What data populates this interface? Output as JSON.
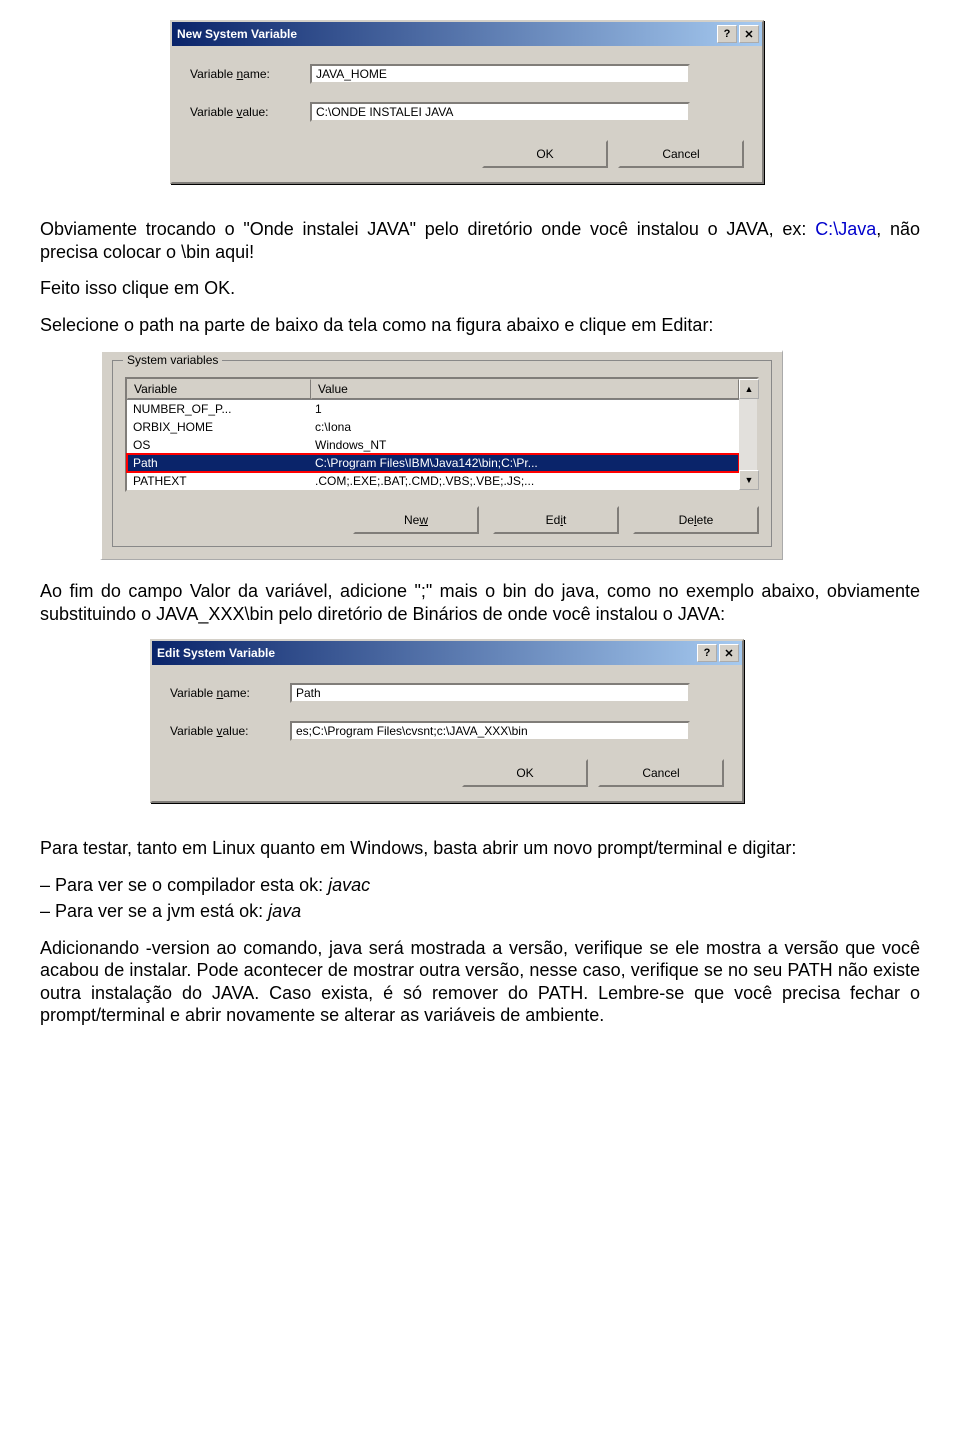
{
  "dialog1": {
    "title": "New System Variable",
    "name_label_pre": "Variable ",
    "name_label_u": "n",
    "name_label_post": "ame:",
    "name_value": "JAVA_HOME",
    "value_label_pre": "Variable ",
    "value_label_u": "v",
    "value_label_post": "alue:",
    "value_value": "C:\\ONDE INSTALEI JAVA",
    "ok": "OK",
    "cancel": "Cancel",
    "help_btn": "?",
    "close_btn": "✕"
  },
  "para1_a": "Obviamente trocando o \"Onde instalei JAVA\" pelo diretório onde você instalou o JAVA, ex: ",
  "para1_link": "C:\\Java",
  "para1_b": ", não precisa colocar o \\bin aqui!",
  "para2": "Feito isso clique em OK.",
  "para3": "Selecione o path na parte de baixo da tela como na figura abaixo e clique em Editar:",
  "sysvar": {
    "legend": "System variables",
    "col_variable": "Variable",
    "col_value": "Value",
    "rows": [
      {
        "name": "NUMBER_OF_P...",
        "value": "1"
      },
      {
        "name": "ORBIX_HOME",
        "value": "c:\\Iona"
      },
      {
        "name": "OS",
        "value": "Windows_NT"
      },
      {
        "name": "Path",
        "value": "C:\\Program Files\\IBM\\Java142\\bin;C:\\Pr..."
      },
      {
        "name": "PATHEXT",
        "value": ".COM;.EXE;.BAT;.CMD;.VBS;.VBE;.JS;..."
      }
    ],
    "btn_new_u": "w",
    "btn_new_pre": "Ne",
    "btn_edit_u": "i",
    "btn_edit_pre": "Ed",
    "btn_edit_post": "t",
    "btn_delete_u": "l",
    "btn_delete_pre": "De",
    "btn_delete_post": "ete",
    "scroll_up": "▲",
    "scroll_down": "▼"
  },
  "para4": "Ao fim do campo Valor da variável, adicione \";\" mais o bin do java, como no exemplo abaixo, obviamente substituindo o JAVA_XXX\\bin pelo diretório de Binários de onde você instalou o JAVA:",
  "dialog2": {
    "title": "Edit System Variable",
    "name_value": "Path",
    "value_value": "es;C:\\Program Files\\cvsnt;c:\\JAVA_XXX\\bin",
    "ok": "OK",
    "cancel": "Cancel",
    "help_btn": "?",
    "close_btn": "✕"
  },
  "para5": "Para testar, tanto em Linux quanto em Windows, basta abrir um novo prompt/terminal e digitar:",
  "bullet1_a": "– Para ver se o compilador esta ok: ",
  "bullet1_b": "javac",
  "bullet2_a": "– Para ver se a jvm está ok: ",
  "bullet2_b": "java",
  "para6": "Adicionando -version ao comando, java será mostrada a versão, verifique se ele mostra a versão que você acabou de instalar. Pode acontecer de mostrar outra versão, nesse caso, verifique se no seu PATH não existe outra instalação do JAVA. Caso exista, é só remover do PATH. Lembre-se que você precisa fechar o prompt/terminal e abrir novamente se alterar as variáveis de ambiente."
}
